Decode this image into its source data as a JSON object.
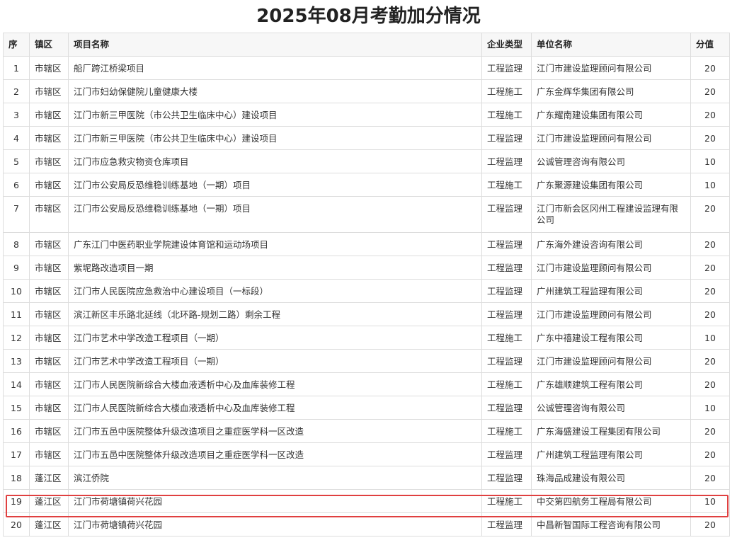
{
  "page": {
    "title": "2025年08月考勤加分情况"
  },
  "table": {
    "headers": {
      "seq": "序",
      "district": "镇区",
      "project": "项目名称",
      "type": "企业类型",
      "company": "单位名称",
      "score": "分值"
    },
    "rows": [
      {
        "seq": "1",
        "district": "市辖区",
        "project": "船厂跨江桥梁项目",
        "type": "工程监理",
        "company": "江门市建设监理顾问有限公司",
        "score": "20"
      },
      {
        "seq": "2",
        "district": "市辖区",
        "project": "江门市妇幼保健院儿童健康大楼",
        "type": "工程施工",
        "company": "广东金辉华集团有限公司",
        "score": "20"
      },
      {
        "seq": "3",
        "district": "市辖区",
        "project": "江门市新三甲医院（市公共卫生临床中心）建设项目",
        "type": "工程施工",
        "company": "广东耀南建设集团有限公司",
        "score": "20"
      },
      {
        "seq": "4",
        "district": "市辖区",
        "project": "江门市新三甲医院（市公共卫生临床中心）建设项目",
        "type": "工程监理",
        "company": "江门市建设监理顾问有限公司",
        "score": "20"
      },
      {
        "seq": "5",
        "district": "市辖区",
        "project": "江门市应急救灾物资仓库项目",
        "type": "工程监理",
        "company": "公诚管理咨询有限公司",
        "score": "10"
      },
      {
        "seq": "6",
        "district": "市辖区",
        "project": "江门市公安局反恐维稳训练基地（一期）项目",
        "type": "工程施工",
        "company": "广东聚源建设集团有限公司",
        "score": "10"
      },
      {
        "seq": "7",
        "district": "市辖区",
        "project": "江门市公安局反恐维稳训练基地（一期）项目",
        "type": "工程监理",
        "company": "江门市新会区冈州工程建设监理有限公司",
        "score": "20"
      },
      {
        "seq": "8",
        "district": "市辖区",
        "project": "广东江门中医药职业学院建设体育馆和运动场项目",
        "type": "工程监理",
        "company": "广东海外建设咨询有限公司",
        "score": "20"
      },
      {
        "seq": "9",
        "district": "市辖区",
        "project": "紫坭路改造项目一期",
        "type": "工程监理",
        "company": "江门市建设监理顾问有限公司",
        "score": "20"
      },
      {
        "seq": "10",
        "district": "市辖区",
        "project": "江门市人民医院应急救治中心建设项目（一标段）",
        "type": "工程监理",
        "company": "广州建筑工程监理有限公司",
        "score": "20"
      },
      {
        "seq": "11",
        "district": "市辖区",
        "project": "滨江新区丰乐路北延线（北环路-规划二路）剩余工程",
        "type": "工程监理",
        "company": "江门市建设监理顾问有限公司",
        "score": "20"
      },
      {
        "seq": "12",
        "district": "市辖区",
        "project": "江门市艺术中学改造工程项目（一期）",
        "type": "工程施工",
        "company": "广东中禧建设工程有限公司",
        "score": "10"
      },
      {
        "seq": "13",
        "district": "市辖区",
        "project": "江门市艺术中学改造工程项目（一期）",
        "type": "工程监理",
        "company": "江门市建设监理顾问有限公司",
        "score": "20"
      },
      {
        "seq": "14",
        "district": "市辖区",
        "project": "江门市人民医院新综合大楼血液透析中心及血库装修工程",
        "type": "工程施工",
        "company": "广东雄顺建筑工程有限公司",
        "score": "20"
      },
      {
        "seq": "15",
        "district": "市辖区",
        "project": "江门市人民医院新综合大楼血液透析中心及血库装修工程",
        "type": "工程监理",
        "company": "公诚管理咨询有限公司",
        "score": "10"
      },
      {
        "seq": "16",
        "district": "市辖区",
        "project": "江门市五邑中医院整体升级改造项目之重症医学科一区改造",
        "type": "工程施工",
        "company": "广东海盛建设工程集团有限公司",
        "score": "20"
      },
      {
        "seq": "17",
        "district": "市辖区",
        "project": "江门市五邑中医院整体升级改造项目之重症医学科一区改造",
        "type": "工程监理",
        "company": "广州建筑工程监理有限公司",
        "score": "20"
      },
      {
        "seq": "18",
        "district": "蓬江区",
        "project": "滨江侨院",
        "type": "工程监理",
        "company": "珠海品成建设有限公司",
        "score": "20"
      },
      {
        "seq": "19",
        "district": "蓬江区",
        "project": "江门市荷塘镇荷兴花园",
        "type": "工程施工",
        "company": "中交第四航务工程局有限公司",
        "score": "10"
      },
      {
        "seq": "20",
        "district": "蓬江区",
        "project": "江门市荷塘镇荷兴花园",
        "type": "工程监理",
        "company": "中昌新智国际工程咨询有限公司",
        "score": "20"
      }
    ]
  },
  "highlight": {
    "color": "#e04040",
    "row_seq": "19"
  }
}
